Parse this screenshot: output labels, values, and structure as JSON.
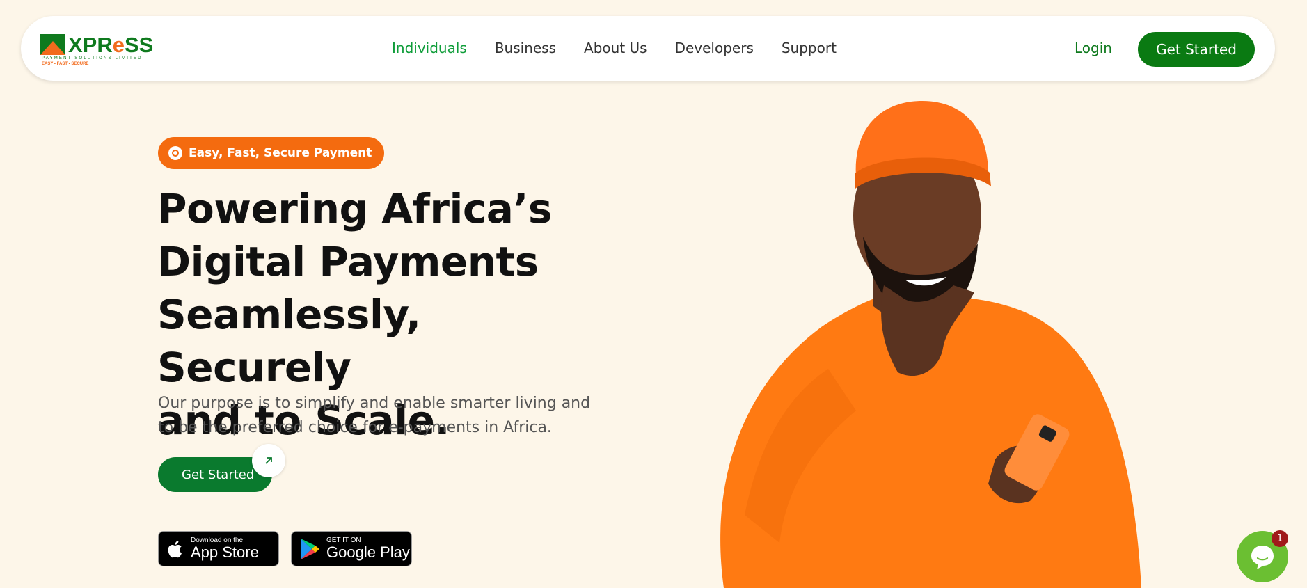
{
  "brand": {
    "name_prefix": "XPR",
    "name_e": "e",
    "name_suffix": "SS",
    "sub": "PAYMENT SOLUTIONS LIMITED",
    "tagline": "EASY • FAST • SECURE",
    "primary_color": "#0a7a12",
    "accent_color": "#f46b0f",
    "background_color": "#fdf6e9"
  },
  "nav": {
    "items": [
      {
        "label": "Individuals",
        "active": true
      },
      {
        "label": "Business",
        "active": false
      },
      {
        "label": "About Us",
        "active": false
      },
      {
        "label": "Developers",
        "active": false
      },
      {
        "label": "Support",
        "active": false
      }
    ],
    "login": "Login",
    "cta": "Get Started"
  },
  "hero": {
    "badge": "Easy, Fast, Secure Payment",
    "headline_lines": [
      "Powering Africa’s",
      "Digital Payments",
      "Seamlessly, Securely",
      "and to Scale."
    ],
    "subtext": "Our purpose is to simplify and enable smarter living and to be the preferred choice for e-payments in Africa.",
    "cta": "Get Started",
    "cta_icon": "arrow-up-right-icon"
  },
  "stores": {
    "apple": {
      "small": "Download on the",
      "big": "App Store"
    },
    "google": {
      "small": "GET IT ON",
      "big": "Google Play"
    }
  },
  "chat": {
    "icon": "chat-bubble-icon",
    "badge_count": "1"
  }
}
